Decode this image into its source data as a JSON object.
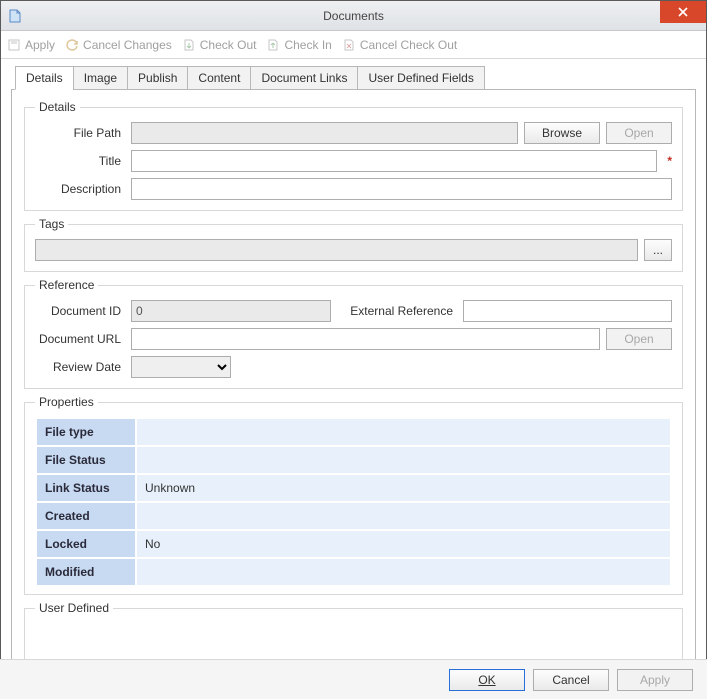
{
  "window": {
    "title": "Documents"
  },
  "toolbar": {
    "apply": "Apply",
    "cancel_changes": "Cancel Changes",
    "check_out": "Check Out",
    "check_in": "Check In",
    "cancel_check_out": "Cancel Check Out"
  },
  "tabs": [
    "Details",
    "Image",
    "Publish",
    "Content",
    "Document Links",
    "User Defined Fields"
  ],
  "details": {
    "legend": "Details",
    "file_path_label": "File Path",
    "file_path_value": "",
    "browse_label": "Browse",
    "open_label": "Open",
    "title_label": "Title",
    "title_value": "",
    "description_label": "Description",
    "description_value": ""
  },
  "tags": {
    "legend": "Tags",
    "value": "",
    "picker_label": "..."
  },
  "reference": {
    "legend": "Reference",
    "document_id_label": "Document ID",
    "document_id_value": "0",
    "external_ref_label": "External Reference",
    "external_ref_value": "",
    "document_url_label": "Document URL",
    "document_url_value": "",
    "open_label": "Open",
    "review_date_label": "Review Date",
    "review_date_value": ""
  },
  "properties": {
    "legend": "Properties",
    "rows": [
      {
        "k": "File type",
        "v": ""
      },
      {
        "k": "File Status",
        "v": ""
      },
      {
        "k": "Link Status",
        "v": "Unknown"
      },
      {
        "k": "Created",
        "v": ""
      },
      {
        "k": "Locked",
        "v": "No"
      },
      {
        "k": "Modified",
        "v": ""
      }
    ]
  },
  "user_defined": {
    "legend": "User Defined"
  },
  "footer": {
    "ok": "OK",
    "cancel": "Cancel",
    "apply": "Apply"
  }
}
